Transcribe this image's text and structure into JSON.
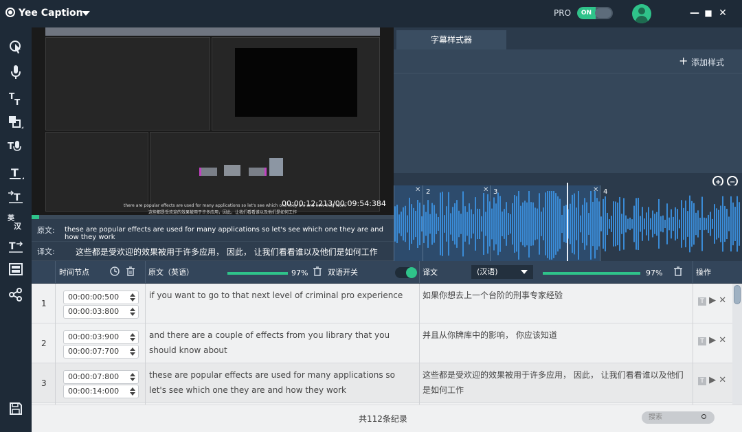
{
  "app": {
    "title": "Yee Caption",
    "pro_label": "PRO",
    "toggle_label": "ON"
  },
  "window_controls": {
    "minimize": "—",
    "maximize": "■",
    "close": "✕"
  },
  "sidebar": {
    "items": [
      {
        "name": "cursor-icon",
        "glyph": "↖"
      },
      {
        "name": "microphone-icon",
        "glyph": "🎙"
      },
      {
        "name": "text-size-icon",
        "glyph": "Tт"
      },
      {
        "name": "shape-icon",
        "glyph": "◩"
      },
      {
        "name": "text-voice-icon",
        "glyph": "T🎙"
      },
      {
        "name": "text-box-icon",
        "glyph": "T"
      },
      {
        "name": "text-import-icon",
        "glyph": "→T"
      },
      {
        "name": "translate-icon",
        "glyph": "英汉"
      },
      {
        "name": "text-export-icon",
        "glyph": "T→"
      },
      {
        "name": "film-icon",
        "glyph": "▤"
      },
      {
        "name": "share-icon",
        "glyph": "⋖"
      },
      {
        "name": "save-icon",
        "glyph": "💾"
      }
    ]
  },
  "video": {
    "timecode": "00:00:12:213/00:09:54:384",
    "subtitle_en": "there are popular effects are used for many applications so let's see which one they are and how they work",
    "subtitle_cn": "这些都是受欢迎的效果被用于许多应用，因此，让我们看看谁以及他们是如何工作"
  },
  "labels": {
    "original_key": "原文:",
    "original_value": "these are popular effects are used for many applications so let's see which one they are and how they work",
    "translation_key": "译文:",
    "translation_value": "这些都是受欢迎的效果被用于许多应用， 因此， 让我们看看谁以及他们是如何工作"
  },
  "style_panel": {
    "tab": "字幕样式器",
    "add_style": "添加样式"
  },
  "waveform": {
    "segments": [
      "2",
      "3",
      "4"
    ]
  },
  "table": {
    "headers": {
      "time": "时间节点",
      "original": "原文（英语）",
      "original_pct": "97%",
      "bilingual": "双语开关",
      "translation": "译文",
      "language": "(汉语)",
      "translation_pct": "97%",
      "ops": "操作"
    },
    "rows": [
      {
        "num": "1",
        "start": "00:00:00:500",
        "end": "00:00:03:800",
        "en": "if you want to go to that next level of criminal pro experience",
        "cn": "如果你想去上一个台阶的刑事专家经验"
      },
      {
        "num": "2",
        "start": "00:00:03:900",
        "end": "00:00:07:700",
        "en": "and there are a couple of effects from you library that you should know about",
        "cn": "并且从你牌库中的影响， 你应该知道"
      },
      {
        "num": "3",
        "start": "00:00:07:800",
        "end": "00:00:14:000",
        "en": "these are popular effects are used for many applications so let's see which one they are and how they work",
        "cn": "这些都是受欢迎的效果被用于许多应用， 因此， 让我们看看谁以及他们是如何工作"
      }
    ],
    "total": "共112条纪录",
    "search_placeholder": "搜索"
  },
  "colors": {
    "accent": "#2fc38a",
    "sidebar": "#1e2a37",
    "panel": "#2b3a4b",
    "wave": "#3a8bd6"
  },
  "progress": {
    "played_fraction": 0.02
  }
}
